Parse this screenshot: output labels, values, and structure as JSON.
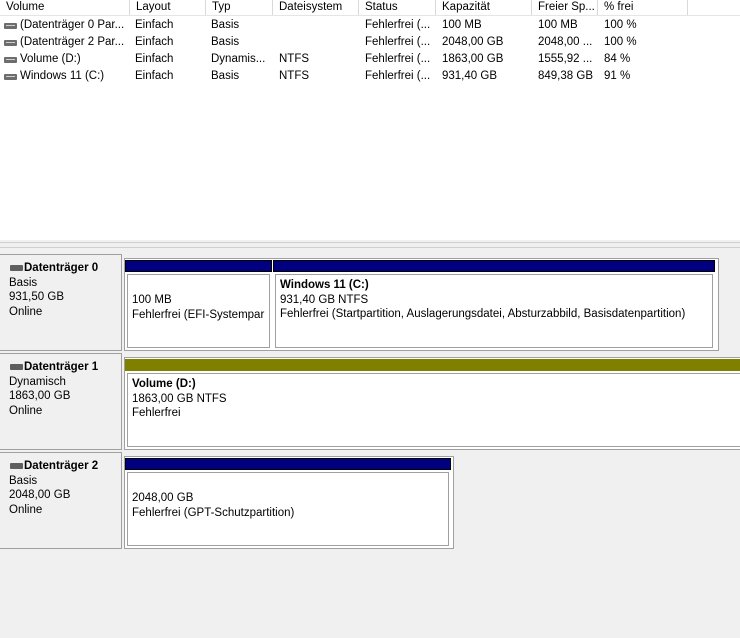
{
  "columns": [
    "Volume",
    "Layout",
    "Typ",
    "Dateisystem",
    "Status",
    "Kapazität",
    "Freier Sp...",
    "% frei"
  ],
  "rows": [
    [
      "(Datenträger 0 Par...",
      "Einfach",
      "Basis",
      "",
      "Fehlerfrei (...",
      "100 MB",
      "100 MB",
      "100 %"
    ],
    [
      "(Datenträger 2 Par...",
      "Einfach",
      "Basis",
      "",
      "Fehlerfrei (...",
      "2048,00 GB",
      "2048,00 ...",
      "100 %"
    ],
    [
      "Volume (D:)",
      "Einfach",
      "Dynamis...",
      "NTFS",
      "Fehlerfrei (...",
      "1863,00 GB",
      "1555,92 ...",
      "84 %"
    ],
    [
      "Windows 11 (C:)",
      "Einfach",
      "Basis",
      "NTFS",
      "Fehlerfrei (...",
      "931,40 GB",
      "849,38 GB",
      "91 %"
    ]
  ],
  "disks": [
    {
      "name": "Datenträger 0",
      "type": "Basis",
      "size": "931,50 GB",
      "state": "Online",
      "partitions": [
        {
          "title": "",
          "line1": "100 MB",
          "line2": "Fehlerfrei (EFI-Systempar"
        },
        {
          "title": "Windows 11  (C:)",
          "line1": "931,40 GB NTFS",
          "line2": "Fehlerfrei (Startpartition, Auslagerungsdatei, Absturzabbild, Basisdatenpartition)"
        }
      ]
    },
    {
      "name": "Datenträger 1",
      "type": "Dynamisch",
      "size": "1863,00 GB",
      "state": "Online",
      "partitions": [
        {
          "title": "Volume  (D:)",
          "line1": "1863,00 GB NTFS",
          "line2": "Fehlerfrei"
        }
      ]
    },
    {
      "name": "Datenträger 2",
      "type": "Basis",
      "size": "2048,00 GB",
      "state": "Online",
      "partitions": [
        {
          "title": "",
          "line1": "2048,00 GB",
          "line2": "Fehlerfrei (GPT-Schutzpartition)"
        }
      ]
    }
  ],
  "colors": {
    "basic_partition": "#000080",
    "simple_volume": "#808000"
  },
  "icons": {
    "volume": "drive-icon",
    "disk": "disk-icon"
  }
}
